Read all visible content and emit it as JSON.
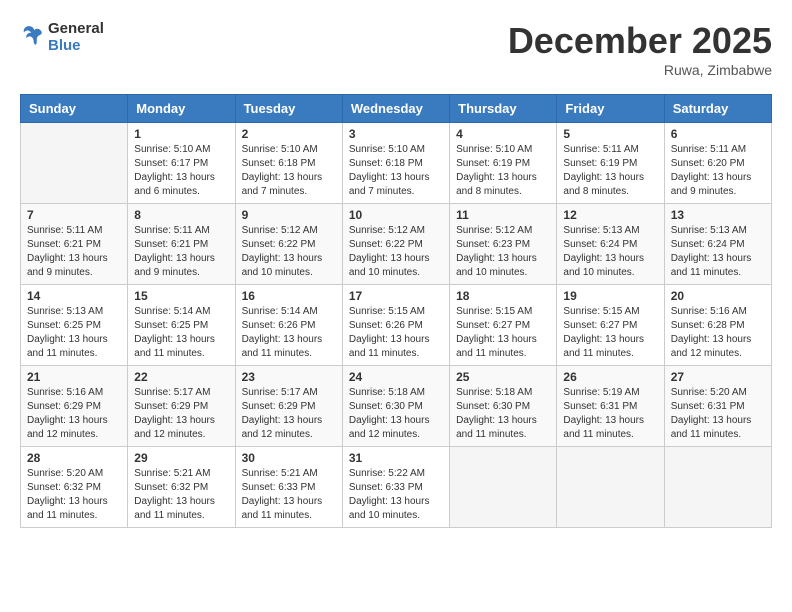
{
  "header": {
    "logo_line1": "General",
    "logo_line2": "Blue",
    "month": "December 2025",
    "location": "Ruwa, Zimbabwe"
  },
  "weekdays": [
    "Sunday",
    "Monday",
    "Tuesday",
    "Wednesday",
    "Thursday",
    "Friday",
    "Saturday"
  ],
  "weeks": [
    [
      {
        "day": "",
        "info": ""
      },
      {
        "day": "1",
        "info": "Sunrise: 5:10 AM\nSunset: 6:17 PM\nDaylight: 13 hours\nand 6 minutes."
      },
      {
        "day": "2",
        "info": "Sunrise: 5:10 AM\nSunset: 6:18 PM\nDaylight: 13 hours\nand 7 minutes."
      },
      {
        "day": "3",
        "info": "Sunrise: 5:10 AM\nSunset: 6:18 PM\nDaylight: 13 hours\nand 7 minutes."
      },
      {
        "day": "4",
        "info": "Sunrise: 5:10 AM\nSunset: 6:19 PM\nDaylight: 13 hours\nand 8 minutes."
      },
      {
        "day": "5",
        "info": "Sunrise: 5:11 AM\nSunset: 6:19 PM\nDaylight: 13 hours\nand 8 minutes."
      },
      {
        "day": "6",
        "info": "Sunrise: 5:11 AM\nSunset: 6:20 PM\nDaylight: 13 hours\nand 9 minutes."
      }
    ],
    [
      {
        "day": "7",
        "info": "Sunrise: 5:11 AM\nSunset: 6:21 PM\nDaylight: 13 hours\nand 9 minutes."
      },
      {
        "day": "8",
        "info": "Sunrise: 5:11 AM\nSunset: 6:21 PM\nDaylight: 13 hours\nand 9 minutes."
      },
      {
        "day": "9",
        "info": "Sunrise: 5:12 AM\nSunset: 6:22 PM\nDaylight: 13 hours\nand 10 minutes."
      },
      {
        "day": "10",
        "info": "Sunrise: 5:12 AM\nSunset: 6:22 PM\nDaylight: 13 hours\nand 10 minutes."
      },
      {
        "day": "11",
        "info": "Sunrise: 5:12 AM\nSunset: 6:23 PM\nDaylight: 13 hours\nand 10 minutes."
      },
      {
        "day": "12",
        "info": "Sunrise: 5:13 AM\nSunset: 6:24 PM\nDaylight: 13 hours\nand 10 minutes."
      },
      {
        "day": "13",
        "info": "Sunrise: 5:13 AM\nSunset: 6:24 PM\nDaylight: 13 hours\nand 11 minutes."
      }
    ],
    [
      {
        "day": "14",
        "info": "Sunrise: 5:13 AM\nSunset: 6:25 PM\nDaylight: 13 hours\nand 11 minutes."
      },
      {
        "day": "15",
        "info": "Sunrise: 5:14 AM\nSunset: 6:25 PM\nDaylight: 13 hours\nand 11 minutes."
      },
      {
        "day": "16",
        "info": "Sunrise: 5:14 AM\nSunset: 6:26 PM\nDaylight: 13 hours\nand 11 minutes."
      },
      {
        "day": "17",
        "info": "Sunrise: 5:15 AM\nSunset: 6:26 PM\nDaylight: 13 hours\nand 11 minutes."
      },
      {
        "day": "18",
        "info": "Sunrise: 5:15 AM\nSunset: 6:27 PM\nDaylight: 13 hours\nand 11 minutes."
      },
      {
        "day": "19",
        "info": "Sunrise: 5:15 AM\nSunset: 6:27 PM\nDaylight: 13 hours\nand 11 minutes."
      },
      {
        "day": "20",
        "info": "Sunrise: 5:16 AM\nSunset: 6:28 PM\nDaylight: 13 hours\nand 12 minutes."
      }
    ],
    [
      {
        "day": "21",
        "info": "Sunrise: 5:16 AM\nSunset: 6:29 PM\nDaylight: 13 hours\nand 12 minutes."
      },
      {
        "day": "22",
        "info": "Sunrise: 5:17 AM\nSunset: 6:29 PM\nDaylight: 13 hours\nand 12 minutes."
      },
      {
        "day": "23",
        "info": "Sunrise: 5:17 AM\nSunset: 6:29 PM\nDaylight: 13 hours\nand 12 minutes."
      },
      {
        "day": "24",
        "info": "Sunrise: 5:18 AM\nSunset: 6:30 PM\nDaylight: 13 hours\nand 12 minutes."
      },
      {
        "day": "25",
        "info": "Sunrise: 5:18 AM\nSunset: 6:30 PM\nDaylight: 13 hours\nand 11 minutes."
      },
      {
        "day": "26",
        "info": "Sunrise: 5:19 AM\nSunset: 6:31 PM\nDaylight: 13 hours\nand 11 minutes."
      },
      {
        "day": "27",
        "info": "Sunrise: 5:20 AM\nSunset: 6:31 PM\nDaylight: 13 hours\nand 11 minutes."
      }
    ],
    [
      {
        "day": "28",
        "info": "Sunrise: 5:20 AM\nSunset: 6:32 PM\nDaylight: 13 hours\nand 11 minutes."
      },
      {
        "day": "29",
        "info": "Sunrise: 5:21 AM\nSunset: 6:32 PM\nDaylight: 13 hours\nand 11 minutes."
      },
      {
        "day": "30",
        "info": "Sunrise: 5:21 AM\nSunset: 6:33 PM\nDaylight: 13 hours\nand 11 minutes."
      },
      {
        "day": "31",
        "info": "Sunrise: 5:22 AM\nSunset: 6:33 PM\nDaylight: 13 hours\nand 10 minutes."
      },
      {
        "day": "",
        "info": ""
      },
      {
        "day": "",
        "info": ""
      },
      {
        "day": "",
        "info": ""
      }
    ]
  ]
}
